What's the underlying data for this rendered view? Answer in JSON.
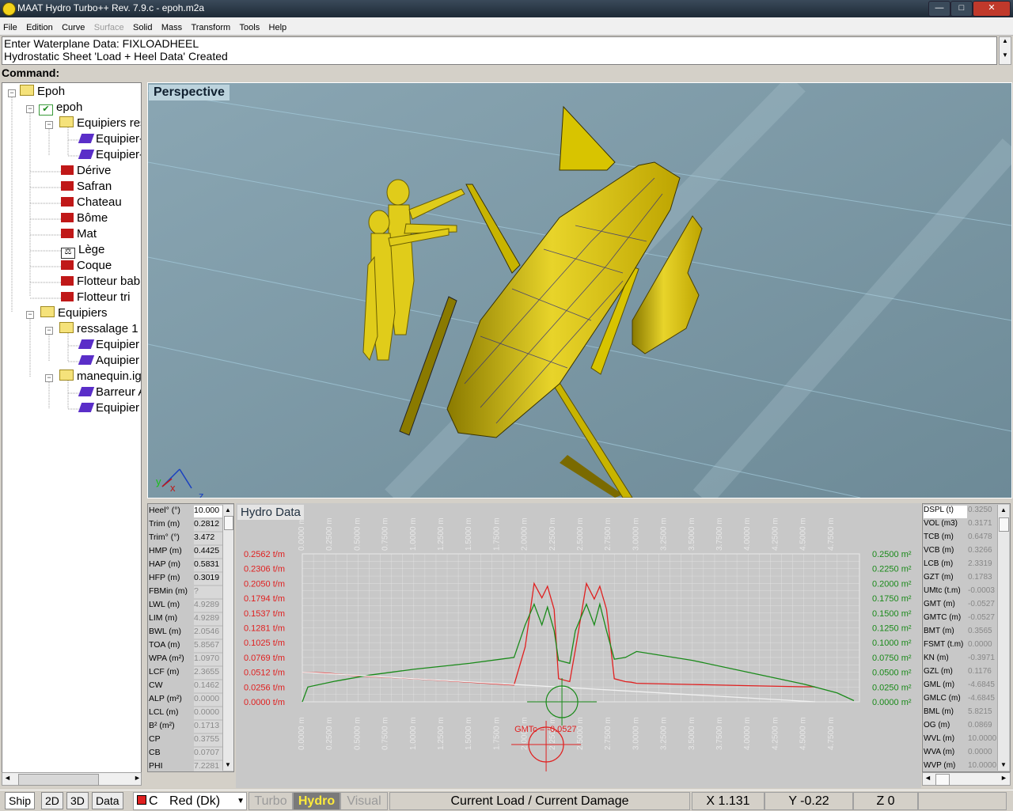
{
  "window": {
    "title": "MAAT Hydro Turbo++ Rev. 7.9.c - epoh.m2a"
  },
  "menu": [
    "File",
    "Edition",
    "Curve",
    "Surface",
    "Solid",
    "Mass",
    "Transform",
    "Tools",
    "Help"
  ],
  "messages": {
    "line1": "Enter Waterplane Data: FIXLOADHEEL",
    "line2": "Hydrostatic Sheet 'Load + Heel Data' Created"
  },
  "command_label": "Command:",
  "tree": [
    {
      "label": "Epoh"
    },
    {
      "label": "epoh"
    },
    {
      "label": "Equipiers res"
    },
    {
      "label": "Equipier-"
    },
    {
      "label": "Equipier-"
    },
    {
      "label": "Dérive"
    },
    {
      "label": "Safran"
    },
    {
      "label": "Chateau"
    },
    {
      "label": "Bôme"
    },
    {
      "label": "Mat"
    },
    {
      "label": "Lège"
    },
    {
      "label": "Coque"
    },
    {
      "label": "Flotteur bab"
    },
    {
      "label": "Flotteur tri"
    },
    {
      "label": "Equipiers"
    },
    {
      "label": "ressalage 1"
    },
    {
      "label": "Equipier"
    },
    {
      "label": "Aquipier"
    },
    {
      "label": "manequin.igs"
    },
    {
      "label": "Barreur A"
    },
    {
      "label": "Equipier"
    }
  ],
  "viewport": {
    "label": "Perspective",
    "axes": {
      "x": "x",
      "y": "y",
      "z": "z"
    }
  },
  "left_table": [
    {
      "k": "Heel° (°)",
      "v": "10.000"
    },
    {
      "k": "Trim (m)",
      "v": "0.2812"
    },
    {
      "k": "Trim° (°)",
      "v": "3.472"
    },
    {
      "k": "HMP (m)",
      "v": "0.4425"
    },
    {
      "k": "HAP (m)",
      "v": "0.5831"
    },
    {
      "k": "HFP (m)",
      "v": "0.3019"
    },
    {
      "k": "FBMin (m)",
      "v": "?"
    },
    {
      "k": "LWL (m)",
      "v": "4.9289"
    },
    {
      "k": "LIM (m)",
      "v": "4.9289"
    },
    {
      "k": "BWL (m)",
      "v": "2.0546"
    },
    {
      "k": "TOA (m)",
      "v": "5.8567"
    },
    {
      "k": "WPA (m²)",
      "v": "1.0970"
    },
    {
      "k": "LCF (m)",
      "v": "2.3655"
    },
    {
      "k": "CW",
      "v": "0.1462"
    },
    {
      "k": "ALP (m²)",
      "v": "0.0000"
    },
    {
      "k": "LCL (m)",
      "v": "0.0000"
    },
    {
      "k": "B² (m²)",
      "v": "0.1713"
    },
    {
      "k": "CP",
      "v": "0.3755"
    },
    {
      "k": "CB",
      "v": "0.0707"
    },
    {
      "k": "PHI",
      "v": "7.2281"
    }
  ],
  "right_table": [
    {
      "k": "DSPL (t)",
      "v": "0.3250"
    },
    {
      "k": "VOL (m3)",
      "v": "0.3171"
    },
    {
      "k": "TCB (m)",
      "v": "0.6478"
    },
    {
      "k": "VCB (m)",
      "v": "0.3266"
    },
    {
      "k": "LCB (m)",
      "v": "2.3319"
    },
    {
      "k": "GZT (m)",
      "v": "0.1783"
    },
    {
      "k": "UMtc (t.m)",
      "v": "-0.0003"
    },
    {
      "k": "GMT (m)",
      "v": "-0.0527"
    },
    {
      "k": "GMTC (m)",
      "v": "-0.0527"
    },
    {
      "k": "BMT (m)",
      "v": "0.3565"
    },
    {
      "k": "FSMT (t.m)",
      "v": "0.0000"
    },
    {
      "k": "KN (m)",
      "v": "-0.3971"
    },
    {
      "k": "GZL (m)",
      "v": "0.1176"
    },
    {
      "k": "GML (m)",
      "v": "-4.6845"
    },
    {
      "k": "GMLC (m)",
      "v": "-4.6845"
    },
    {
      "k": "BML (m)",
      "v": "5.8215"
    },
    {
      "k": "OG (m)",
      "v": "0.0869"
    },
    {
      "k": "WVL (m)",
      "v": "10.0000"
    },
    {
      "k": "WVA (m)",
      "v": "0.0000"
    },
    {
      "k": "WVP (m)",
      "v": "10.0000"
    }
  ],
  "hydro": {
    "label": "Hydro Data",
    "gmt_label": "GMTc = -0.0527",
    "colors": {
      "load": "#e02020",
      "area": "#1a8a1a",
      "grid": "#e8e8e8"
    }
  },
  "chart_data": {
    "type": "line",
    "x_ticks": [
      "0.0000 m",
      "0.2500 m",
      "0.5000 m",
      "0.7500 m",
      "1.0000 m",
      "1.2500 m",
      "1.5000 m",
      "1.7500 m",
      "2.0000 m",
      "2.2500 m",
      "2.5000 m",
      "2.7500 m",
      "3.0000 m",
      "3.2500 m",
      "3.5000 m",
      "3.7500 m",
      "4.0000 m",
      "4.2500 m",
      "4.5000 m",
      "4.7500 m"
    ],
    "left_ticks": [
      "0.2562 t/m",
      "0.2306 t/m",
      "0.2050 t/m",
      "0.1794 t/m",
      "0.1537 t/m",
      "0.1281 t/m",
      "0.1025 t/m",
      "0.0769 t/m",
      "0.0512 t/m",
      "0.0256 t/m",
      "0.0000 t/m"
    ],
    "right_ticks": [
      "0.2500 m²",
      "0.2250 m²",
      "0.2000 m²",
      "0.1750 m²",
      "0.1500 m²",
      "0.1250 m²",
      "0.1000 m²",
      "0.0750 m²",
      "0.0500 m²",
      "0.0250 m²",
      "0.0000 m²"
    ],
    "xlim": [
      0,
      5.0
    ],
    "ylim_left": [
      0,
      0.2562
    ],
    "ylim_right": [
      0,
      0.25
    ],
    "series": [
      {
        "color": "#e02020",
        "axis": "left",
        "x": [
          0.0,
          0.2,
          0.5,
          1.0,
          1.5,
          1.9,
          2.0,
          2.08,
          2.15,
          2.2,
          2.26,
          2.3,
          2.4,
          2.45,
          2.55,
          2.62,
          2.67,
          2.73,
          2.8,
          2.9,
          2.95,
          3.0,
          3.5,
          4.0,
          4.5,
          4.6
        ],
        "y": [
          0.0512,
          0.05,
          0.045,
          0.04,
          0.034,
          0.029,
          0.095,
          0.205,
          0.18,
          0.2,
          0.16,
          0.04,
          0.035,
          0.09,
          0.205,
          0.178,
          0.2,
          0.16,
          0.04,
          0.035,
          0.034,
          0.032,
          0.03,
          0.028,
          0.026,
          0.026
        ]
      },
      {
        "color": "#1a8a1a",
        "axis": "right",
        "x": [
          0.0,
          0.05,
          0.3,
          0.6,
          1.0,
          1.5,
          1.9,
          2.0,
          2.08,
          2.15,
          2.2,
          2.26,
          2.3,
          2.4,
          2.45,
          2.55,
          2.62,
          2.67,
          2.73,
          2.8,
          2.9,
          3.0,
          3.5,
          4.0,
          4.5,
          4.8,
          4.95
        ],
        "y": [
          0.0,
          0.025,
          0.035,
          0.045,
          0.055,
          0.065,
          0.075,
          0.13,
          0.165,
          0.13,
          0.16,
          0.12,
          0.07,
          0.065,
          0.12,
          0.165,
          0.13,
          0.165,
          0.12,
          0.072,
          0.075,
          0.085,
          0.07,
          0.05,
          0.03,
          0.015,
          0.002
        ]
      },
      {
        "color": "#f0f0f0",
        "axis": "left",
        "x": [
          0.0,
          4.6
        ],
        "y": [
          0.0512,
          0.0
        ]
      }
    ]
  },
  "statusbar": {
    "tabs": [
      "Ship",
      "2D",
      "3D",
      "Data"
    ],
    "color_select": "Red (Dk)",
    "color_prefix": "C",
    "modes": [
      "Turbo",
      "Hydro",
      "Visual"
    ],
    "status": "Current Load / Current Damage",
    "x": "X 1.131",
    "y": "Y -0.22",
    "z": "Z 0"
  }
}
